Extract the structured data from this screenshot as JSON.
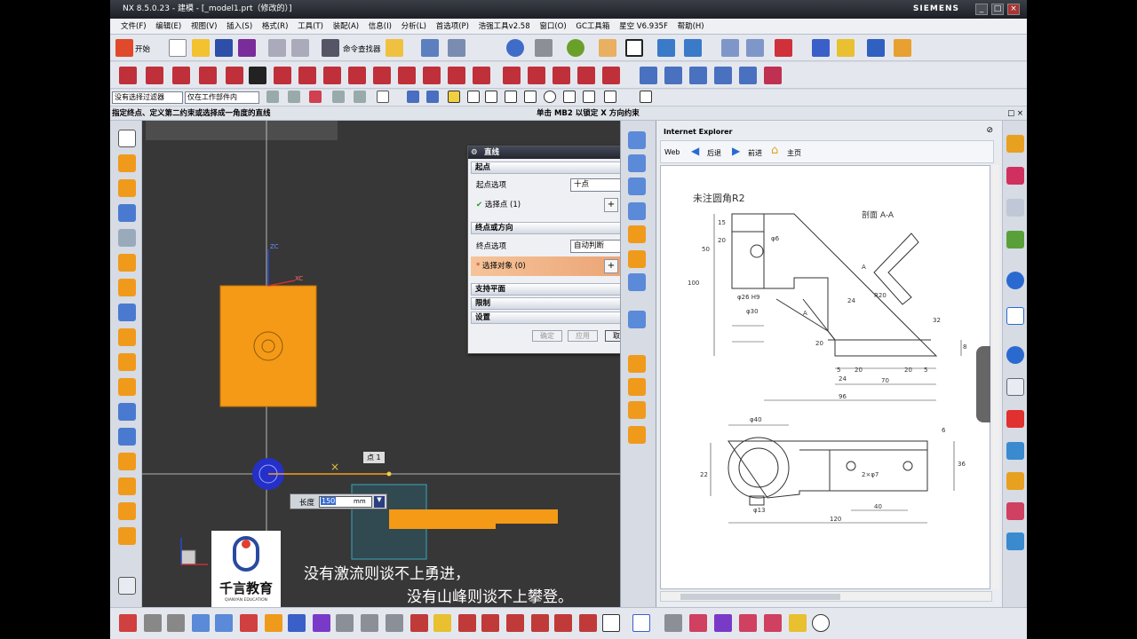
{
  "window": {
    "title": "NX 8.5.0.23 - 建模 - [_model1.prt（修改的）]",
    "brand": "SIEMENS",
    "buttons": [
      "_",
      "□",
      "×"
    ]
  },
  "menu": [
    "文件(F)",
    "编辑(E)",
    "视图(V)",
    "插入(S)",
    "格式(R)",
    "工具(T)",
    "装配(A)",
    "信息(I)",
    "分析(L)",
    "首选项(P)",
    "浩强工具v2.58",
    "窗口(O)",
    "GC工具箱",
    "星空 V6.935F",
    "帮助(H)"
  ],
  "toolbar1": {
    "start_label": "开始",
    "finder_label": "命令查找器"
  },
  "filters": {
    "type_filter": "没有选择过滤器",
    "scope_filter": "仅在工作部件内"
  },
  "cue": {
    "prompt": "指定终点、定义第二约束或选择成一角度的直线",
    "status": "单击 MB2 以锁定 X 方向约束"
  },
  "dialog": {
    "title": "直线",
    "sec_start": "起点",
    "start_option_label": "起点选项",
    "start_option_value": "十点",
    "select_point_label": "选择点 (1)",
    "sec_end": "终点或方向",
    "end_option_label": "终点选项",
    "end_option_value": "自动判断",
    "select_object_label": "选择对象 (0)",
    "sec_support": "支持平面",
    "sec_limit": "限制",
    "sec_settings": "设置",
    "ok": "确定",
    "apply": "应用",
    "cancel": "取消"
  },
  "viewport": {
    "point_tag": "点 1",
    "length_label": "长度",
    "length_value": "150",
    "length_unit": "mm",
    "axis_z": "ZC",
    "axis_x": "XC",
    "logo_text": "千言教育",
    "logo_sub": "QIANYAN EDUCATION",
    "caption1": "没有激流则谈不上勇进，",
    "caption2": "没有山峰则谈不上攀登。"
  },
  "browser": {
    "title": "Internet Explorer",
    "web_label": "Web",
    "back_label": "后退",
    "forward_label": "前进",
    "home_label": "主页"
  },
  "drawing": {
    "note": "未注圆角R2",
    "section_label": "剖面 A-A",
    "dims": [
      "20",
      "50",
      "15",
      "φ26 H9",
      "φ30",
      "100",
      "R20",
      "24",
      "32",
      "20",
      "5",
      "20",
      "20",
      "5",
      "24",
      "70",
      "96",
      "8",
      "A",
      "A",
      "φ40",
      "φ13",
      "40",
      "120",
      "6",
      "36",
      "22",
      "2×φ7",
      "φ6"
    ]
  },
  "colors": {
    "accent_orange": "#ff9f10",
    "viewport_bg": "#373737",
    "dialog_header": "#2a2d36"
  }
}
